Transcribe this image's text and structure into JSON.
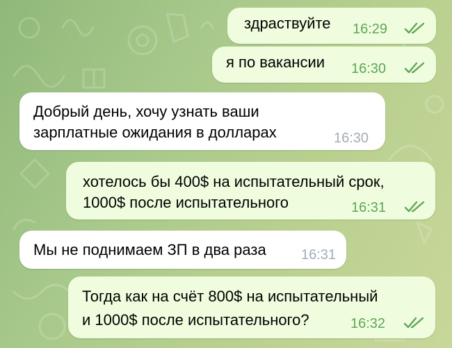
{
  "theme": {
    "outgoing_bubble": "#effdde",
    "incoming_bubble": "#ffffff",
    "outgoing_time": "#5fa557",
    "incoming_time": "#a3acb5",
    "check_color": "#5fa557"
  },
  "messages": [
    {
      "direction": "out",
      "lines": [
        "здраствуйте"
      ],
      "time": "16:29",
      "status_icon": "double-check-read-icon"
    },
    {
      "direction": "out",
      "lines": [
        "я по вакансии"
      ],
      "time": "16:30",
      "status_icon": "double-check-read-icon"
    },
    {
      "direction": "in",
      "lines": [
        "Добрый день, хочу узнать ваши",
        "зарплатные ожидания в долларах"
      ],
      "time": "16:30"
    },
    {
      "direction": "out",
      "lines": [
        "хотелось бы 400$ на испытательный срок,",
        "1000$ после испытательного"
      ],
      "time": "16:31",
      "status_icon": "double-check-read-icon"
    },
    {
      "direction": "in",
      "lines": [
        "Мы не поднимаем ЗП в два раза"
      ],
      "time": "16:31"
    },
    {
      "direction": "out",
      "lines": [
        "Тогда как на счёт 800$ на испытательный",
        "и 1000$ после испытательного?"
      ],
      "time": "16:32",
      "status_icon": "double-check-read-icon"
    }
  ]
}
